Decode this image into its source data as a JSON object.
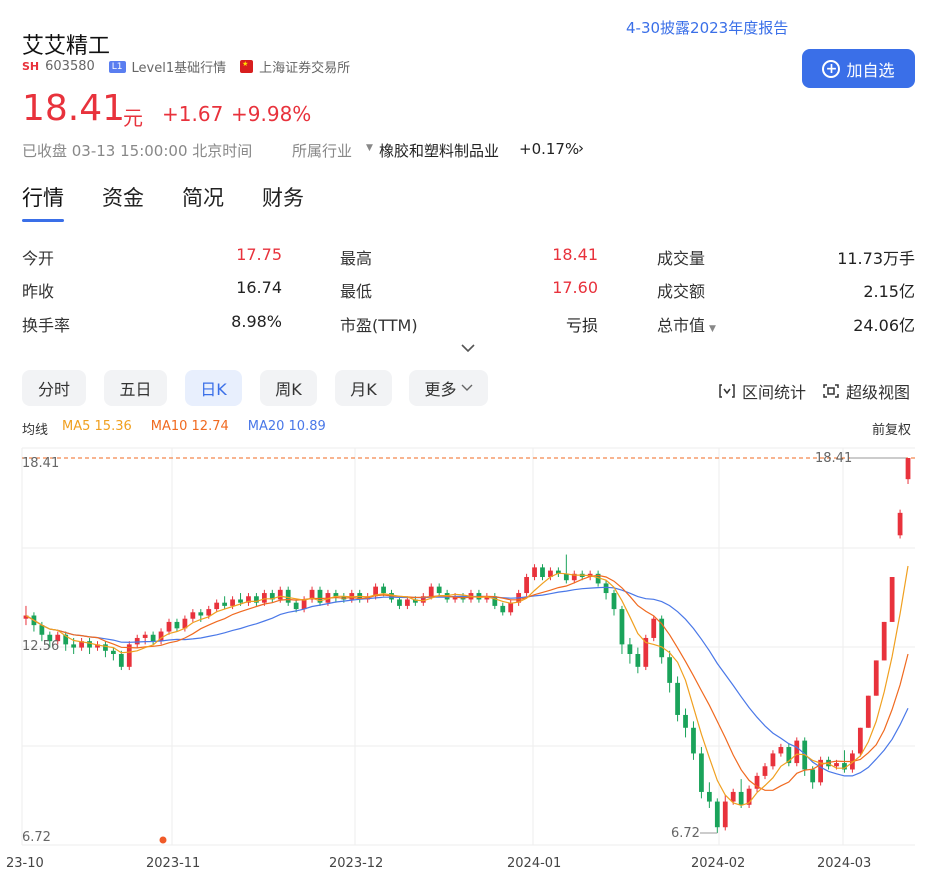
{
  "stock": {
    "name": "艾艾精工",
    "market_tag": "SH",
    "code": "603580",
    "level_tag": "L1",
    "level_text": "Level1基础行情",
    "exchange": "上海证券交易所",
    "report_link": "4-30披露2023年度报告",
    "price": "18.41",
    "unit": "元",
    "change": "+1.67",
    "change_pct": "+9.98%",
    "add_button": "加自选",
    "status": "已收盘 03-13 15:00:00 北京时间",
    "industry_label": "所属行业",
    "industry_name": "橡胶和塑料制品业",
    "industry_pct": "+0.17%"
  },
  "tabs": [
    "行情",
    "资金",
    "简况",
    "财务"
  ],
  "stats": [
    {
      "label": "今开",
      "value": "17.75",
      "color": "#e8323c"
    },
    {
      "label": "最高",
      "value": "18.41",
      "color": "#e8323c"
    },
    {
      "label": "成交量",
      "value": "11.73万手",
      "color": "#222222"
    },
    {
      "label": "昨收",
      "value": "16.74",
      "color": "#222222"
    },
    {
      "label": "最低",
      "value": "17.60",
      "color": "#e8323c"
    },
    {
      "label": "成交额",
      "value": "2.15亿",
      "color": "#222222"
    },
    {
      "label": "换手率",
      "value": "8.98%",
      "color": "#222222"
    },
    {
      "label": "市盈(TTM)",
      "value": "亏损",
      "color": "#222222"
    },
    {
      "label": "总市值",
      "value": "24.06亿",
      "color": "#222222"
    }
  ],
  "period_tabs": [
    "分时",
    "五日",
    "日K",
    "周K",
    "月K",
    "更多"
  ],
  "active_period": "日K",
  "tools": {
    "range_stats": "区间统计",
    "super_view": "超级视图"
  },
  "legend": {
    "label": "均线",
    "ma5": "MA5 15.36",
    "ma10": "MA10 12.74",
    "ma20": "MA20 10.89",
    "adjust": "前复权",
    "ma5_color": "#f0a020",
    "ma10_color": "#f06a20",
    "ma20_color": "#4a78e8"
  },
  "chart_data": {
    "type": "candlestick",
    "y_ticks": [
      "18.41",
      "12.56",
      "6.72"
    ],
    "high_marker": "18.41",
    "low_marker": "6.72",
    "x_labels": [
      "23-10",
      "2023-11",
      "2023-12",
      "2024-01",
      "2024-02",
      "2024-03"
    ],
    "up_color": "#e8323c",
    "down_color": "#1aa35a",
    "ylim": [
      6.72,
      18.41
    ],
    "candles": [
      [
        13.4,
        13.5,
        13.8,
        13.2
      ],
      [
        13.5,
        13.2,
        13.6,
        13.0
      ],
      [
        13.2,
        12.9,
        13.3,
        12.7
      ],
      [
        12.9,
        12.7,
        13.0,
        12.5
      ],
      [
        12.7,
        12.9,
        13.0,
        12.6
      ],
      [
        12.9,
        12.6,
        13.0,
        12.4
      ],
      [
        12.6,
        12.5,
        12.8,
        12.3
      ],
      [
        12.5,
        12.7,
        12.8,
        12.4
      ],
      [
        12.7,
        12.5,
        12.8,
        12.3
      ],
      [
        12.5,
        12.6,
        12.7,
        12.4
      ],
      [
        12.6,
        12.4,
        12.7,
        12.2
      ],
      [
        12.4,
        12.3,
        12.5,
        12.1
      ],
      [
        12.3,
        11.9,
        12.4,
        11.8
      ],
      [
        11.9,
        12.6,
        12.7,
        11.8
      ],
      [
        12.6,
        12.8,
        12.9,
        12.5
      ],
      [
        12.8,
        12.9,
        13.0,
        12.6
      ],
      [
        12.9,
        12.7,
        13.0,
        12.6
      ],
      [
        12.7,
        13.0,
        13.1,
        12.6
      ],
      [
        13.0,
        13.3,
        13.4,
        12.9
      ],
      [
        13.3,
        13.1,
        13.4,
        13.0
      ],
      [
        13.1,
        13.4,
        13.5,
        13.0
      ],
      [
        13.4,
        13.6,
        13.7,
        13.3
      ],
      [
        13.6,
        13.5,
        13.7,
        13.3
      ],
      [
        13.5,
        13.7,
        13.8,
        13.4
      ],
      [
        13.7,
        13.9,
        14.0,
        13.6
      ],
      [
        13.9,
        13.8,
        14.1,
        13.7
      ],
      [
        13.8,
        14.0,
        14.1,
        13.7
      ],
      [
        14.0,
        13.9,
        14.2,
        13.8
      ],
      [
        13.9,
        14.1,
        14.2,
        13.8
      ],
      [
        14.1,
        13.9,
        14.2,
        13.8
      ],
      [
        13.9,
        14.2,
        14.3,
        13.8
      ],
      [
        14.2,
        14.0,
        14.3,
        13.9
      ],
      [
        14.0,
        14.3,
        14.4,
        13.9
      ],
      [
        14.3,
        13.9,
        14.4,
        13.8
      ],
      [
        13.9,
        13.7,
        14.0,
        13.6
      ],
      [
        13.7,
        14.0,
        14.1,
        13.6
      ],
      [
        14.0,
        14.3,
        14.4,
        13.9
      ],
      [
        14.3,
        13.9,
        14.4,
        13.8
      ],
      [
        13.9,
        14.2,
        14.3,
        13.8
      ],
      [
        14.2,
        14.1,
        14.3,
        13.9
      ],
      [
        14.1,
        14.0,
        14.2,
        13.9
      ],
      [
        14.0,
        14.2,
        14.3,
        13.9
      ],
      [
        14.2,
        14.0,
        14.3,
        13.9
      ],
      [
        14.0,
        14.1,
        14.2,
        13.9
      ],
      [
        14.1,
        14.4,
        14.5,
        14.0
      ],
      [
        14.4,
        14.2,
        14.5,
        14.1
      ],
      [
        14.2,
        14.0,
        14.3,
        13.9
      ],
      [
        14.0,
        13.8,
        14.1,
        13.7
      ],
      [
        13.8,
        14.0,
        14.1,
        13.7
      ],
      [
        14.0,
        13.9,
        14.1,
        13.8
      ],
      [
        13.9,
        14.1,
        14.2,
        13.8
      ],
      [
        14.1,
        14.4,
        14.5,
        14.0
      ],
      [
        14.4,
        14.2,
        14.5,
        14.1
      ],
      [
        14.2,
        14.0,
        14.3,
        13.9
      ],
      [
        14.0,
        14.1,
        14.2,
        13.9
      ],
      [
        14.1,
        14.0,
        14.2,
        13.9
      ],
      [
        14.0,
        14.2,
        14.3,
        13.9
      ],
      [
        14.2,
        14.0,
        14.3,
        13.9
      ],
      [
        14.0,
        14.1,
        14.2,
        13.9
      ],
      [
        14.1,
        13.8,
        14.2,
        13.7
      ],
      [
        13.8,
        13.6,
        13.9,
        13.5
      ],
      [
        13.6,
        13.9,
        14.0,
        13.5
      ],
      [
        13.9,
        14.2,
        14.3,
        13.8
      ],
      [
        14.2,
        14.7,
        14.8,
        14.1
      ],
      [
        14.7,
        15.0,
        15.1,
        14.6
      ],
      [
        15.0,
        14.7,
        15.1,
        14.6
      ],
      [
        14.7,
        14.9,
        15.0,
        14.6
      ],
      [
        14.9,
        14.8,
        15.0,
        14.7
      ],
      [
        14.8,
        14.6,
        15.4,
        14.5
      ],
      [
        14.6,
        14.8,
        14.9,
        14.5
      ],
      [
        14.8,
        14.7,
        14.9,
        14.6
      ],
      [
        14.7,
        14.8,
        14.9,
        14.6
      ],
      [
        14.8,
        14.5,
        14.9,
        14.4
      ],
      [
        14.5,
        14.2,
        14.6,
        14.0
      ],
      [
        14.2,
        13.7,
        14.3,
        13.5
      ],
      [
        13.7,
        12.6,
        13.8,
        12.3
      ],
      [
        12.6,
        12.3,
        12.8,
        12.0
      ],
      [
        12.3,
        11.9,
        12.5,
        11.7
      ],
      [
        11.9,
        12.8,
        12.9,
        11.8
      ],
      [
        12.8,
        13.4,
        13.5,
        12.7
      ],
      [
        13.4,
        12.2,
        13.5,
        12.0
      ],
      [
        12.2,
        11.4,
        12.4,
        11.1
      ],
      [
        11.4,
        10.4,
        11.6,
        10.2
      ],
      [
        10.4,
        10.0,
        10.6,
        9.7
      ],
      [
        10.0,
        9.2,
        10.2,
        9.0
      ],
      [
        9.2,
        8.0,
        9.4,
        7.8
      ],
      [
        8.0,
        7.7,
        8.3,
        7.5
      ],
      [
        7.7,
        6.9,
        7.8,
        6.72
      ],
      [
        6.9,
        7.7,
        7.9,
        6.8
      ],
      [
        7.7,
        8.0,
        8.1,
        7.6
      ],
      [
        8.0,
        7.6,
        8.4,
        7.5
      ],
      [
        7.6,
        8.1,
        8.2,
        7.5
      ],
      [
        8.1,
        8.5,
        8.6,
        8.0
      ],
      [
        8.5,
        8.8,
        8.9,
        8.4
      ],
      [
        8.8,
        9.2,
        9.3,
        8.7
      ],
      [
        9.2,
        9.4,
        9.5,
        9.1
      ],
      [
        9.4,
        8.9,
        9.5,
        8.8
      ],
      [
        8.9,
        9.6,
        9.7,
        8.8
      ],
      [
        9.6,
        8.7,
        9.7,
        8.5
      ],
      [
        8.7,
        8.3,
        8.8,
        8.1
      ],
      [
        8.3,
        9.0,
        9.1,
        8.2
      ],
      [
        9.0,
        8.8,
        9.1,
        8.7
      ],
      [
        8.8,
        8.9,
        9.0,
        8.7
      ],
      [
        8.9,
        8.7,
        9.3,
        8.6
      ],
      [
        8.7,
        9.2,
        9.3,
        8.6
      ],
      [
        9.2,
        10.0,
        10.0,
        9.1
      ],
      [
        10.0,
        11.0,
        11.0,
        10.0
      ],
      [
        11.0,
        12.1,
        12.1,
        11.0
      ],
      [
        12.1,
        13.3,
        13.3,
        12.1
      ],
      [
        13.3,
        14.7,
        14.7,
        13.3
      ],
      [
        16.0,
        16.7,
        16.8,
        15.9
      ],
      [
        17.75,
        18.41,
        18.41,
        17.6
      ]
    ]
  }
}
